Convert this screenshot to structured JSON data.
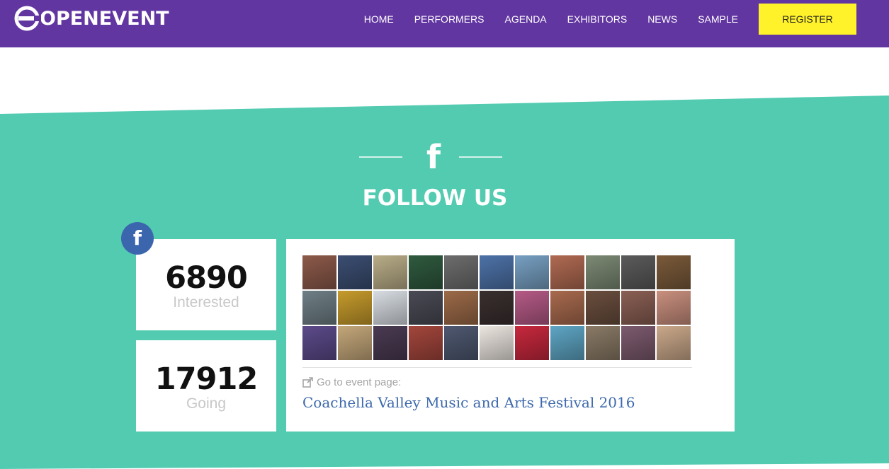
{
  "brand": {
    "name": "OPENEVENT"
  },
  "nav": {
    "items": [
      {
        "label": "HOME"
      },
      {
        "label": "PERFORMERS"
      },
      {
        "label": "AGENDA"
      },
      {
        "label": "EXHIBITORS"
      },
      {
        "label": "NEWS"
      },
      {
        "label": "SAMPLE"
      }
    ],
    "register_label": "REGISTER"
  },
  "follow": {
    "title": "FOLLOW US",
    "icon": "facebook-icon"
  },
  "stats": [
    {
      "value": "6890",
      "label": "Interested"
    },
    {
      "value": "17912",
      "label": "Going"
    }
  ],
  "event": {
    "goto_label": "Go to event page:",
    "name": "Coachella Valley Music and Arts Festival 2016"
  },
  "colors": {
    "nav_bg": "#6236a0",
    "band_bg": "#52cbb0",
    "register_bg": "#fff22b",
    "facebook_blue": "#3b65ad",
    "link_blue": "#3d69ad"
  },
  "avatars": [
    "#8c5a4a",
    "#3b4e72",
    "#b9ad88",
    "#2f5a3f",
    "#6d6d6d",
    "#4d72a8",
    "#77a0c2",
    "#b06a52",
    "#7c8a74",
    "#5b5b5b",
    "#7a5a3a",
    "#6f7f86",
    "#c69b2c",
    "#d8dde3",
    "#4a4a55",
    "#9c6a48",
    "#3a2f2f",
    "#b55a86",
    "#a86a4e",
    "#6a4e3e",
    "#8a5f54",
    "#c98f7e",
    "#5c4a8a",
    "#c4a77a",
    "#4a3a52",
    "#a3463c",
    "#4e5870",
    "#ece6e0",
    "#c7283d",
    "#5ea5c4",
    "#8a7a66",
    "#7c5a6e",
    "#caa88a"
  ]
}
